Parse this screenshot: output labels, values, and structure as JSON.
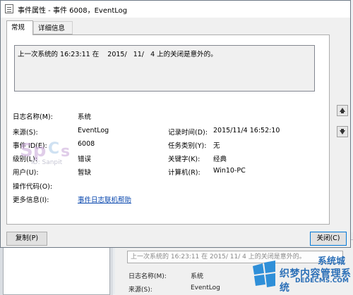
{
  "window": {
    "title": "事件属性 - 事件 6008，EventLog"
  },
  "tabs": [
    {
      "label": "常规"
    },
    {
      "label": "详细信息"
    }
  ],
  "description": "上一次系统的 16:23:11 在    2015/   11/   4 上的关闭是意外的。",
  "fields": {
    "log_name": {
      "label": "日志名称(M):",
      "value": "系统"
    },
    "source": {
      "label": "来源(S):",
      "value": "EventLog"
    },
    "logged": {
      "label": "记录时间(D):",
      "value": "2015/11/4 16:52:10"
    },
    "event_id": {
      "label": "事件 ID(E):",
      "value": "6008"
    },
    "task_category": {
      "label": "任务类别(Y):",
      "value": "无"
    },
    "level": {
      "label": "级别(L):",
      "value": "错误"
    },
    "keywords": {
      "label": "关键字(K):",
      "value": "经典"
    },
    "user": {
      "label": "用户(U):",
      "value": "暂缺"
    },
    "computer": {
      "label": "计算机(R):",
      "value": "Win10-PC"
    },
    "opcode": {
      "label": "操作代码(O):",
      "value": ""
    },
    "more_info": {
      "label": "更多信息(I):",
      "value": "事件日志联机帮助"
    }
  },
  "buttons": {
    "copy": "复制(P)",
    "close": "关闭(C)"
  },
  "side_buttons": [
    "up-arrow-icon",
    "down-arrow-icon"
  ],
  "overlay_watermark": "ID: Sanpit",
  "background": {
    "desc": "上一次系统的 16:23:11 在    2015/   11/   4 上的关闭是意外的。",
    "log_name_label": "日志名称(M):",
    "log_name_value": "系统",
    "source_label": "来源(S):",
    "source_value": "EventLog"
  },
  "brand_watermark": {
    "text": "织梦内容管理系统",
    "sub": "DEDECMS.COM",
    "brand": "系统城"
  }
}
